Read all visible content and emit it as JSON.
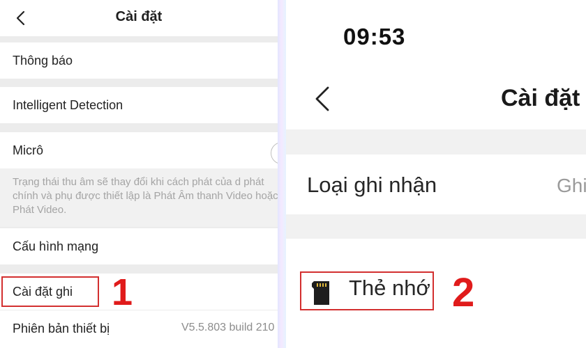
{
  "left": {
    "header": {
      "title": "Cài đặt"
    },
    "rows": [
      {
        "label": "Thông báo"
      },
      {
        "label": "Intelligent Detection"
      },
      {
        "label": "Micrô",
        "description": "Trạng thái thu âm sẽ thay đổi khi cách phát của d phát chính và phụ được thiết lập là Phát Âm thanh Video hoặc Phát Video."
      },
      {
        "label": "Cấu hình mạng"
      },
      {
        "label": "Cài đặt ghi"
      },
      {
        "label": "Phiên bản thiết bị",
        "value": "V5.5.803 build 210"
      }
    ],
    "step": "1"
  },
  "right": {
    "status": {
      "time": "09:53"
    },
    "header": {
      "title": "Cài đặt"
    },
    "rows": [
      {
        "label": "Loại ghi nhận",
        "value": "Ghi"
      },
      {
        "label": "Thẻ nhớ"
      }
    ],
    "step": "2"
  },
  "colors": {
    "highlight": "#d32f2f",
    "step_number": "#e01b1b",
    "divider": "#e8ecff"
  },
  "icons": {
    "back": "chevron-left-icon",
    "memory_card": "sd-card-icon"
  }
}
